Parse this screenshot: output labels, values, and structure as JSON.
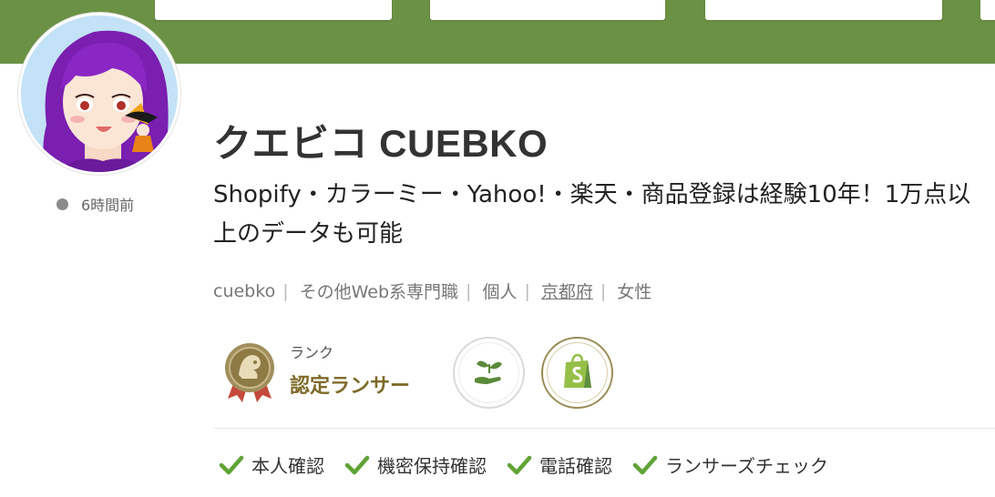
{
  "profile": {
    "name": "クエビコ CUEBKO",
    "tagline": "Shopify・カラーミー・Yahoo!・楽天・商品登録は経験10年！1万点以上のデータも可能",
    "last_active": "6時間前"
  },
  "meta": {
    "username": "cuebko",
    "occupation": "その他Web系専門職",
    "type": "個人",
    "location": "京都府",
    "gender": "女性"
  },
  "rank": {
    "label": "ランク",
    "value": "認定ランサー"
  },
  "badges": [
    {
      "icon": "sprout-hand-icon"
    },
    {
      "icon": "shopify-bag-icon"
    }
  ],
  "verifications": [
    {
      "label": "本人確認"
    },
    {
      "label": "機密保持確認"
    },
    {
      "label": "電話確認"
    },
    {
      "label": "ランサーズチェック"
    }
  ],
  "colors": {
    "cover": "#6b9244",
    "rank_gold": "#7e6a28",
    "check_green": "#5fa335"
  }
}
